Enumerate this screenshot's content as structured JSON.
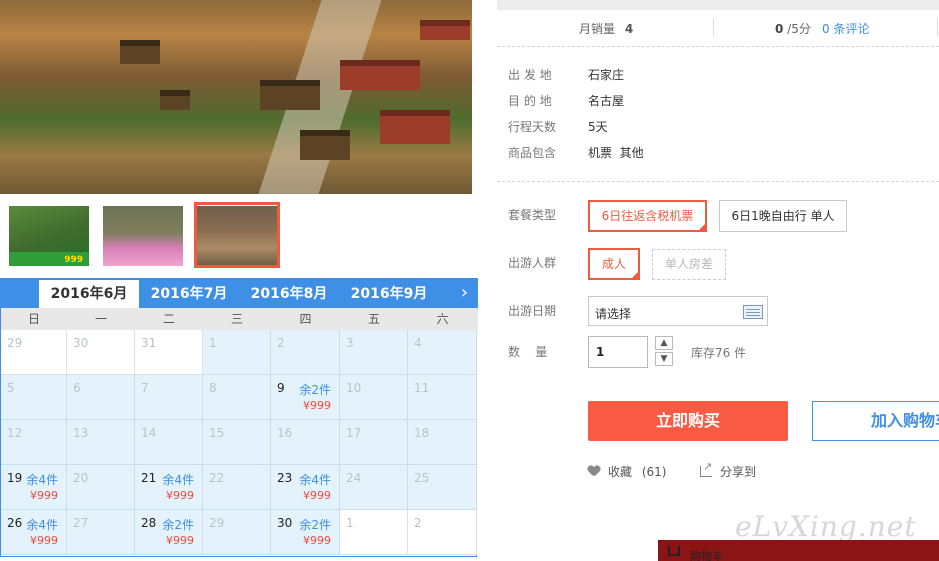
{
  "photo": {
    "thumbnails": [
      {
        "name": "gate",
        "price": "999"
      },
      {
        "name": "flowers"
      },
      {
        "name": "village"
      }
    ]
  },
  "calendar": {
    "tabs": [
      "2016年6月",
      "2016年7月",
      "2016年8月",
      "2016年9月"
    ],
    "next": "›",
    "weekdays": [
      "日",
      "一",
      "二",
      "三",
      "四",
      "五",
      "六"
    ],
    "weeks": [
      [
        {
          "d": "29"
        },
        {
          "d": "30"
        },
        {
          "d": "31"
        },
        {
          "d": "1"
        },
        {
          "d": "2"
        },
        {
          "d": "3"
        },
        {
          "d": "4"
        }
      ],
      [
        {
          "d": "5"
        },
        {
          "d": "6"
        },
        {
          "d": "7"
        },
        {
          "d": "8"
        },
        {
          "d": "9",
          "stock": "余2件",
          "price": "¥999"
        },
        {
          "d": "10"
        },
        {
          "d": "11"
        }
      ],
      [
        {
          "d": "12"
        },
        {
          "d": "13"
        },
        {
          "d": "14"
        },
        {
          "d": "15"
        },
        {
          "d": "16"
        },
        {
          "d": "17"
        },
        {
          "d": "18"
        }
      ],
      [
        {
          "d": "19",
          "stock": "余4件",
          "price": "¥999"
        },
        {
          "d": "20"
        },
        {
          "d": "21",
          "stock": "余4件",
          "price": "¥999"
        },
        {
          "d": "22"
        },
        {
          "d": "23",
          "stock": "余4件",
          "price": "¥999"
        },
        {
          "d": "24"
        },
        {
          "d": "25"
        }
      ],
      [
        {
          "d": "26",
          "stock": "余4件",
          "price": "¥999"
        },
        {
          "d": "27"
        },
        {
          "d": "28",
          "stock": "余2件",
          "price": "¥999"
        },
        {
          "d": "29"
        },
        {
          "d": "30",
          "stock": "余2件",
          "price": "¥999"
        },
        {
          "d": "1"
        },
        {
          "d": "2"
        }
      ]
    ]
  },
  "sales": {
    "label": "月销量",
    "count": "4",
    "rating": "0",
    "rating_suffix": " /5分",
    "reviews": "0 条评论"
  },
  "info": {
    "departure_label": "出 发 地",
    "departure": "石家庄",
    "destination_label": "目 的 地",
    "destination": "名古屋",
    "days_label": "行程天数",
    "days": "5天",
    "includes_label": "商品包含",
    "includes": "机票  其他"
  },
  "options": {
    "package_label": "套餐类型",
    "packages": [
      "6日往返含税机票",
      "6日1晚自由行 单人"
    ],
    "people_label": "出游人群",
    "people": [
      "成人",
      "单人房差"
    ],
    "date_label": "出游日期",
    "date_placeholder": "请选择",
    "qty_label": "数    量",
    "qty": "1",
    "stock": "库存76 件"
  },
  "actions": {
    "buy": "立即购买",
    "cart": "加入购物车",
    "fav": "收藏",
    "fav_count": "(61)",
    "share": "分享到"
  },
  "watermark": "eLvXing.net",
  "cart_float": "购物车",
  "colors": {
    "accent": "#f85a43",
    "blue": "#3e8fe6"
  }
}
